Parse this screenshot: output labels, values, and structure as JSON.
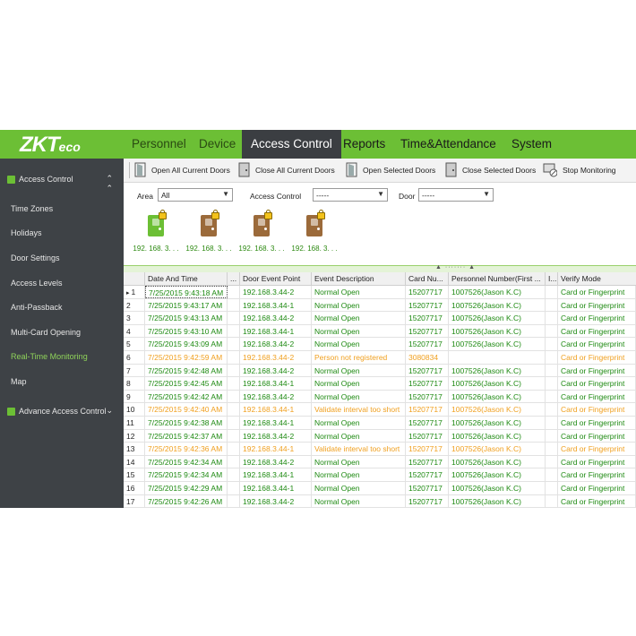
{
  "brand": {
    "logo_main": "ZKT",
    "logo_tail": "eco"
  },
  "nav": [
    {
      "label": "Personnel",
      "active": false
    },
    {
      "label": "Device",
      "active": false
    },
    {
      "label": "Access Control",
      "active": true
    },
    {
      "label": "Reports",
      "active": false
    },
    {
      "label": "Time&Attendance",
      "active": false
    },
    {
      "label": "System",
      "active": false
    }
  ],
  "sidebar": {
    "section_top": {
      "label": "Access Control",
      "chevron": "double-up"
    },
    "items": [
      {
        "label": "Time Zones"
      },
      {
        "label": "Holidays"
      },
      {
        "label": "Door Settings"
      },
      {
        "label": "Access Levels"
      },
      {
        "label": "Anti-Passback"
      },
      {
        "label": "Multi-Card Opening"
      },
      {
        "label": "Real-Time Monitoring",
        "active": true
      },
      {
        "label": "Map"
      }
    ],
    "section_bottom": {
      "label": "Advance Access Control",
      "chevron": "double-down"
    }
  },
  "toolbar": {
    "open_all": "Open All Current Doors",
    "close_all": "Close All Current Doors",
    "open_selected": "Open Selected Doors",
    "close_selected": "Close Selected Doors",
    "stop_monitoring": "Stop Monitoring"
  },
  "filters": {
    "area_label": "Area",
    "area_value": "All",
    "access_label": "Access Control",
    "access_value": "-----",
    "door_label": "Door",
    "door_value": "-----"
  },
  "doors": [
    {
      "caption": "192. 168. 3. . .",
      "state": "open",
      "color": "#6cbf35"
    },
    {
      "caption": "192. 168. 3. . .",
      "state": "closed",
      "color": "#9b6a3a"
    },
    {
      "caption": "192. 168. 3. . .",
      "state": "closed",
      "color": "#9b6a3a"
    },
    {
      "caption": "192. 168. 3. . .",
      "state": "closed",
      "color": "#9b6a3a"
    }
  ],
  "table": {
    "columns": [
      "",
      "Date And Time",
      "...",
      "Door Event Point",
      "Event Description",
      "Card Nu...",
      "Personnel Number(First ...",
      "I...",
      "Verify Mode"
    ],
    "rows": [
      {
        "no": "1",
        "dt": "7/25/2015 9:43:18 AM",
        "dp": "192.168.3.44-2",
        "ev": "Normal Open",
        "card": "15207717",
        "pn": "1007526(Jason K.C)",
        "vm": "Card or Fingerprint",
        "status": "ok"
      },
      {
        "no": "2",
        "dt": "7/25/2015 9:43:17 AM",
        "dp": "192.168.3.44-1",
        "ev": "Normal Open",
        "card": "15207717",
        "pn": "1007526(Jason K.C)",
        "vm": "Card or Fingerprint",
        "status": "ok"
      },
      {
        "no": "3",
        "dt": "7/25/2015 9:43:13 AM",
        "dp": "192.168.3.44-2",
        "ev": "Normal Open",
        "card": "15207717",
        "pn": "1007526(Jason K.C)",
        "vm": "Card or Fingerprint",
        "status": "ok"
      },
      {
        "no": "4",
        "dt": "7/25/2015 9:43:10 AM",
        "dp": "192.168.3.44-1",
        "ev": "Normal Open",
        "card": "15207717",
        "pn": "1007526(Jason K.C)",
        "vm": "Card or Fingerprint",
        "status": "ok"
      },
      {
        "no": "5",
        "dt": "7/25/2015 9:43:09 AM",
        "dp": "192.168.3.44-2",
        "ev": "Normal Open",
        "card": "15207717",
        "pn": "1007526(Jason K.C)",
        "vm": "Card or Fingerprint",
        "status": "ok"
      },
      {
        "no": "6",
        "dt": "7/25/2015 9:42:59 AM",
        "dp": "192.168.3.44-2",
        "ev": "Person not registered",
        "card": "3080834",
        "pn": "",
        "vm": "Card or Fingerprint",
        "status": "warn"
      },
      {
        "no": "7",
        "dt": "7/25/2015 9:42:48 AM",
        "dp": "192.168.3.44-2",
        "ev": "Normal Open",
        "card": "15207717",
        "pn": "1007526(Jason K.C)",
        "vm": "Card or Fingerprint",
        "status": "ok"
      },
      {
        "no": "8",
        "dt": "7/25/2015 9:42:45 AM",
        "dp": "192.168.3.44-1",
        "ev": "Normal Open",
        "card": "15207717",
        "pn": "1007526(Jason K.C)",
        "vm": "Card or Fingerprint",
        "status": "ok"
      },
      {
        "no": "9",
        "dt": "7/25/2015 9:42:42 AM",
        "dp": "192.168.3.44-2",
        "ev": "Normal Open",
        "card": "15207717",
        "pn": "1007526(Jason K.C)",
        "vm": "Card or Fingerprint",
        "status": "ok"
      },
      {
        "no": "10",
        "dt": "7/25/2015 9:42:40 AM",
        "dp": "192.168.3.44-1",
        "ev": "Validate interval too short",
        "card": "15207717",
        "pn": "1007526(Jason K.C)",
        "vm": "Card or Fingerprint",
        "status": "warn"
      },
      {
        "no": "11",
        "dt": "7/25/2015 9:42:38 AM",
        "dp": "192.168.3.44-1",
        "ev": "Normal Open",
        "card": "15207717",
        "pn": "1007526(Jason K.C)",
        "vm": "Card or Fingerprint",
        "status": "ok"
      },
      {
        "no": "12",
        "dt": "7/25/2015 9:42:37 AM",
        "dp": "192.168.3.44-2",
        "ev": "Normal Open",
        "card": "15207717",
        "pn": "1007526(Jason K.C)",
        "vm": "Card or Fingerprint",
        "status": "ok"
      },
      {
        "no": "13",
        "dt": "7/25/2015 9:42:36 AM",
        "dp": "192.168.3.44-1",
        "ev": "Validate interval too short",
        "card": "15207717",
        "pn": "1007526(Jason K.C)",
        "vm": "Card or Fingerprint",
        "status": "warn"
      },
      {
        "no": "14",
        "dt": "7/25/2015 9:42:34 AM",
        "dp": "192.168.3.44-2",
        "ev": "Normal Open",
        "card": "15207717",
        "pn": "1007526(Jason K.C)",
        "vm": "Card or Fingerprint",
        "status": "ok"
      },
      {
        "no": "15",
        "dt": "7/25/2015 9:42:34 AM",
        "dp": "192.168.3.44-1",
        "ev": "Normal Open",
        "card": "15207717",
        "pn": "1007526(Jason K.C)",
        "vm": "Card or Fingerprint",
        "status": "ok"
      },
      {
        "no": "16",
        "dt": "7/25/2015 9:42:29 AM",
        "dp": "192.168.3.44-1",
        "ev": "Normal Open",
        "card": "15207717",
        "pn": "1007526(Jason K.C)",
        "vm": "Card or Fingerprint",
        "status": "ok"
      },
      {
        "no": "17",
        "dt": "7/25/2015 9:42:26 AM",
        "dp": "192.168.3.44-2",
        "ev": "Normal Open",
        "card": "15207717",
        "pn": "1007526(Jason K.C)",
        "vm": "Card or Fingerprint",
        "status": "ok"
      }
    ]
  },
  "colors": {
    "accent": "#6cbf35",
    "sidebar": "#3e4246",
    "ok_text": "#1e8a12",
    "warn_text": "#f0a020",
    "nav_active": "#3b3e42"
  }
}
